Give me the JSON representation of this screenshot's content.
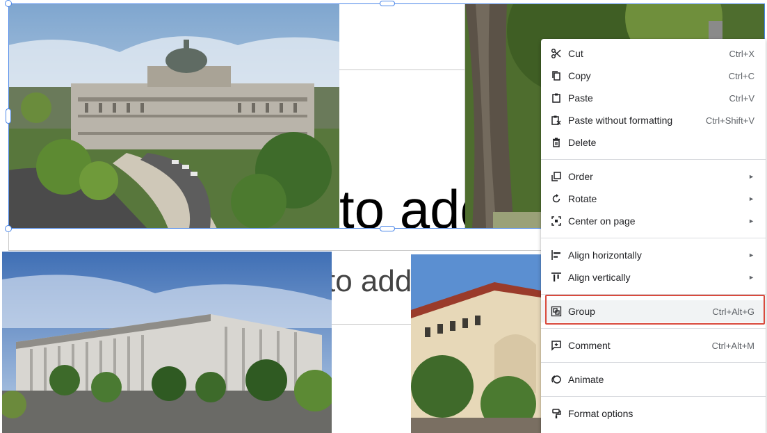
{
  "slide": {
    "placeholder_title": "to add",
    "placeholder_subtitle": "to add"
  },
  "photos": [
    {
      "name": "library-of-congress-jefferson-building"
    },
    {
      "name": "tree-trunk-photo"
    },
    {
      "name": "library-of-congress-madison-building"
    },
    {
      "name": "ornate-stone-building"
    }
  ],
  "context_menu": {
    "items": [
      {
        "id": "cut",
        "icon": "scissors-icon",
        "label": "Cut",
        "shortcut": "Ctrl+X"
      },
      {
        "id": "copy",
        "icon": "copy-icon",
        "label": "Copy",
        "shortcut": "Ctrl+C"
      },
      {
        "id": "paste",
        "icon": "clipboard-icon",
        "label": "Paste",
        "shortcut": "Ctrl+V"
      },
      {
        "id": "paste-plain",
        "icon": "paste-no-format-icon",
        "label": "Paste without formatting",
        "shortcut": "Ctrl+Shift+V"
      },
      {
        "id": "delete",
        "icon": "trash-icon",
        "label": "Delete",
        "shortcut": ""
      },
      {
        "id": "order",
        "icon": "order-icon",
        "label": "Order",
        "submenu": true
      },
      {
        "id": "rotate",
        "icon": "rotate-icon",
        "label": "Rotate",
        "submenu": true
      },
      {
        "id": "center",
        "icon": "center-icon",
        "label": "Center on page",
        "submenu": true
      },
      {
        "id": "align-h",
        "icon": "align-horizontal-icon",
        "label": "Align horizontally",
        "submenu": true
      },
      {
        "id": "align-v",
        "icon": "align-vertical-icon",
        "label": "Align vertically",
        "submenu": true
      },
      {
        "id": "group",
        "icon": "group-icon",
        "label": "Group",
        "shortcut": "Ctrl+Alt+G",
        "highlighted": true
      },
      {
        "id": "comment",
        "icon": "comment-icon",
        "label": "Comment",
        "shortcut": "Ctrl+Alt+M"
      },
      {
        "id": "animate",
        "icon": "animate-icon",
        "label": "Animate",
        "shortcut": ""
      },
      {
        "id": "format",
        "icon": "paint-roller-icon",
        "label": "Format options",
        "shortcut": ""
      }
    ],
    "submenu_arrow": "►",
    "highlight_color": "#d94a3d"
  }
}
